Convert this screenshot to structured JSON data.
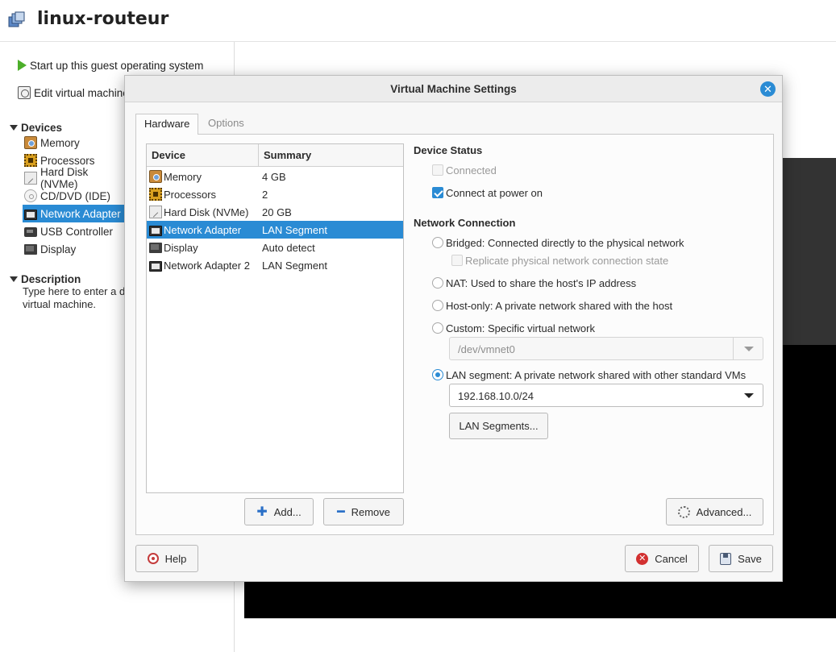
{
  "window": {
    "title": "linux-routeur"
  },
  "sidebar": {
    "actions": {
      "start": "Start up this guest operating system",
      "edit": "Edit virtual machine settings"
    },
    "devices_heading": "Devices",
    "devices": [
      {
        "label": "Memory",
        "icon": "memory-icon"
      },
      {
        "label": "Processors",
        "icon": "processor-icon"
      },
      {
        "label": "Hard Disk (NVMe)",
        "icon": "hard-disk-icon"
      },
      {
        "label": "CD/DVD (IDE)",
        "icon": "cd-dvd-icon"
      },
      {
        "label": "Network Adapter",
        "icon": "network-adapter-icon"
      },
      {
        "label": "USB Controller",
        "icon": "usb-icon"
      },
      {
        "label": "Display",
        "icon": "display-icon"
      }
    ],
    "description_heading": "Description",
    "description_text_line1": "Type here to enter a description of this",
    "description_text_line2": "virtual machine."
  },
  "dialog": {
    "title": "Virtual Machine Settings",
    "tabs": [
      "Hardware",
      "Options"
    ],
    "table": {
      "headers": [
        "Device",
        "Summary"
      ],
      "rows": [
        {
          "device": "Memory",
          "summary": "4 GB"
        },
        {
          "device": "Processors",
          "summary": "2"
        },
        {
          "device": "Hard Disk (NVMe)",
          "summary": "20 GB"
        },
        {
          "device": "Network Adapter",
          "summary": "LAN Segment"
        },
        {
          "device": "Display",
          "summary": "Auto detect"
        },
        {
          "device": "Network Adapter 2",
          "summary": "LAN Segment"
        }
      ]
    },
    "add_label": "Add...",
    "remove_label": "Remove",
    "device_status": {
      "heading": "Device Status",
      "connected": "Connected",
      "connect_power_on": "Connect at power on"
    },
    "network_connection": {
      "heading": "Network Connection",
      "bridged": "Bridged: Connected directly to the physical network",
      "replicate": "Replicate physical network connection state",
      "nat": "NAT: Used to share the host's IP address",
      "host_only": "Host-only: A private network shared with the host",
      "custom": "Custom: Specific virtual network",
      "custom_value": "/dev/vmnet0",
      "lan_segment": "LAN segment: A private network shared with other standard VMs",
      "lan_value": "192.168.10.0/24",
      "lan_segments_button": "LAN Segments..."
    },
    "advanced_label": "Advanced...",
    "help_label": "Help",
    "cancel_label": "Cancel",
    "save_label": "Save"
  },
  "colors": {
    "accent": "#2a8bd4",
    "cancel": "#d23030"
  }
}
